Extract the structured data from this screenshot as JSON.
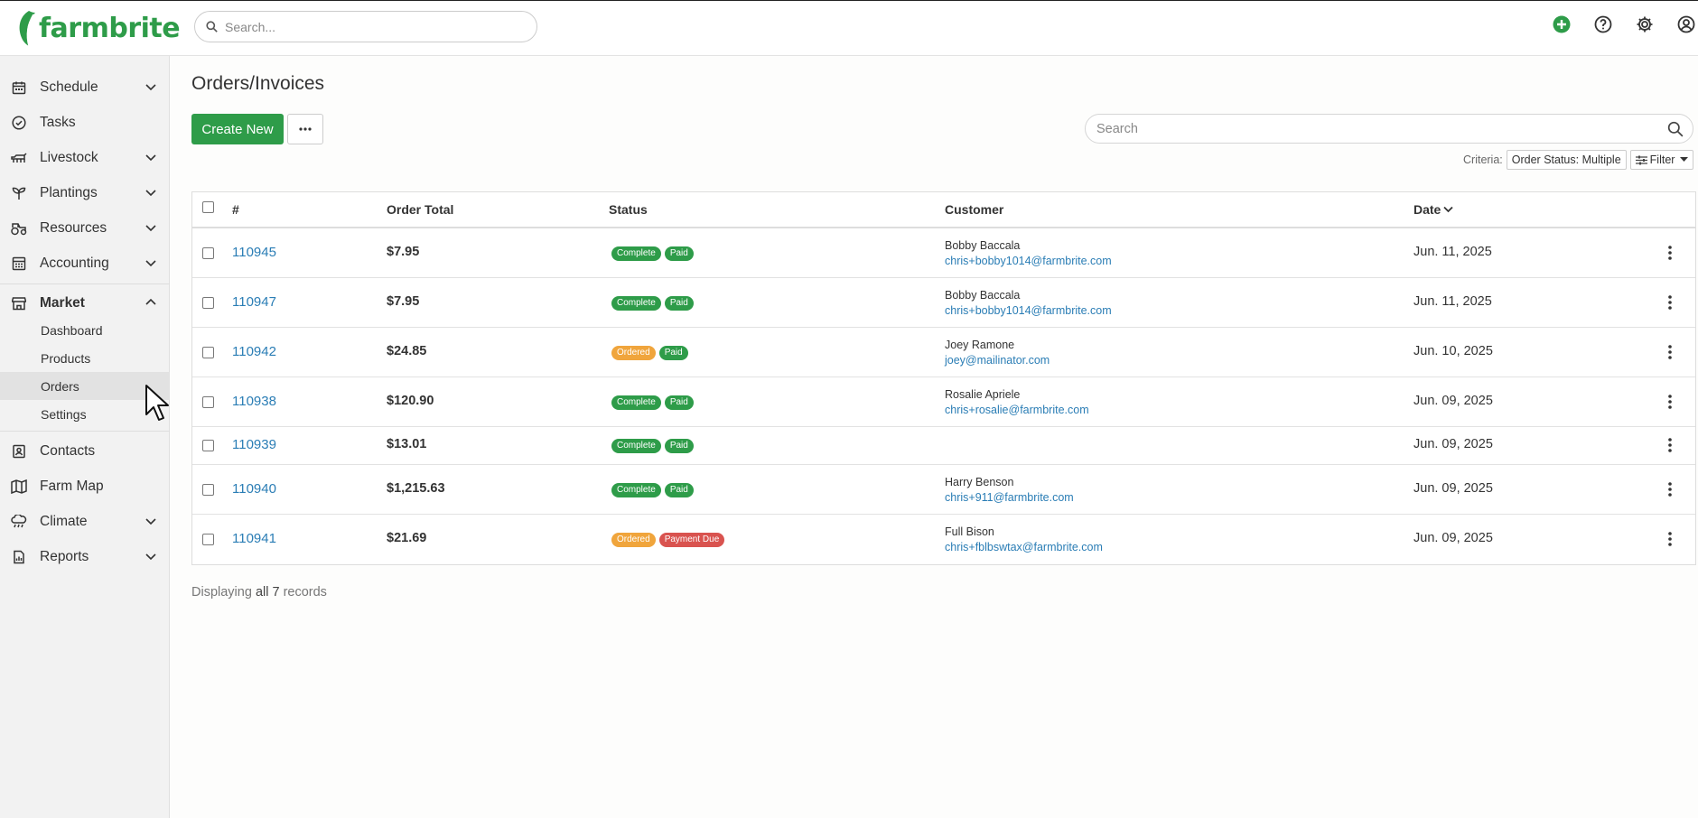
{
  "brand": {
    "name": "farmbrite",
    "color": "#2e9c49"
  },
  "header": {
    "search_placeholder": "Search..."
  },
  "sidebar": {
    "items": [
      {
        "label": "Schedule",
        "icon": "calendar-icon",
        "expandable": true
      },
      {
        "label": "Tasks",
        "icon": "check-circle-icon",
        "expandable": false
      },
      {
        "label": "Livestock",
        "icon": "livestock-icon",
        "expandable": true
      },
      {
        "label": "Plantings",
        "icon": "sprout-icon",
        "expandable": true
      },
      {
        "label": "Resources",
        "icon": "tractor-icon",
        "expandable": true
      },
      {
        "label": "Accounting",
        "icon": "calculator-icon",
        "expandable": true
      },
      {
        "label": "Market",
        "icon": "store-icon",
        "expandable": true,
        "expanded": true
      },
      {
        "label": "Contacts",
        "icon": "contact-card-icon",
        "expandable": false
      },
      {
        "label": "Farm Map",
        "icon": "map-icon",
        "expandable": false
      },
      {
        "label": "Climate",
        "icon": "cloud-rain-icon",
        "expandable": true
      },
      {
        "label": "Reports",
        "icon": "report-icon",
        "expandable": true
      }
    ],
    "market_sub": [
      "Dashboard",
      "Products",
      "Orders",
      "Settings"
    ],
    "active_sub": "Orders"
  },
  "main": {
    "title": "Orders/Invoices",
    "create_label": "Create New",
    "search_placeholder": "Search",
    "criteria_label": "Criteria:",
    "criteria_value": "Order Status: Multiple",
    "filter_label": "Filter",
    "columns": {
      "num": "#",
      "total": "Order Total",
      "status": "Status",
      "customer": "Customer",
      "date": "Date"
    },
    "rows": [
      {
        "id": "110945",
        "total": "$7.95",
        "statuses": [
          {
            "text": "Complete",
            "color": "#2e9c49"
          },
          {
            "text": "Paid",
            "color": "#2e9c49"
          }
        ],
        "name": "Bobby Baccala",
        "email": "chris+bobby1014@farmbrite.com",
        "date": "Jun. 11, 2025"
      },
      {
        "id": "110947",
        "total": "$7.95",
        "statuses": [
          {
            "text": "Complete",
            "color": "#2e9c49"
          },
          {
            "text": "Paid",
            "color": "#2e9c49"
          }
        ],
        "name": "Bobby Baccala",
        "email": "chris+bobby1014@farmbrite.com",
        "date": "Jun. 11, 2025"
      },
      {
        "id": "110942",
        "total": "$24.85",
        "statuses": [
          {
            "text": "Ordered",
            "color": "#f0a53c"
          },
          {
            "text": "Paid",
            "color": "#2e9c49"
          }
        ],
        "name": "Joey Ramone",
        "email": "joey@mailinator.com",
        "date": "Jun. 10, 2025"
      },
      {
        "id": "110938",
        "total": "$120.90",
        "statuses": [
          {
            "text": "Complete",
            "color": "#2e9c49"
          },
          {
            "text": "Paid",
            "color": "#2e9c49"
          }
        ],
        "name": "Rosalie Apriele",
        "email": "chris+rosalie@farmbrite.com",
        "date": "Jun. 09, 2025"
      },
      {
        "id": "110939",
        "total": "$13.01",
        "statuses": [
          {
            "text": "Complete",
            "color": "#2e9c49"
          },
          {
            "text": "Paid",
            "color": "#2e9c49"
          }
        ],
        "name": "",
        "email": "",
        "date": "Jun. 09, 2025"
      },
      {
        "id": "110940",
        "total": "$1,215.63",
        "statuses": [
          {
            "text": "Complete",
            "color": "#2e9c49"
          },
          {
            "text": "Paid",
            "color": "#2e9c49"
          }
        ],
        "name": "Harry Benson",
        "email": "chris+911@farmbrite.com",
        "date": "Jun. 09, 2025"
      },
      {
        "id": "110941",
        "total": "$21.69",
        "statuses": [
          {
            "text": "Ordered",
            "color": "#f0a53c"
          },
          {
            "text": "Payment Due",
            "color": "#d9534f"
          }
        ],
        "name": "Full Bison",
        "email": "chris+fblbswtax@farmbrite.com",
        "date": "Jun. 09, 2025"
      }
    ],
    "records_prefix": "Displaying",
    "records_all": "all 7",
    "records_suffix": "records"
  }
}
